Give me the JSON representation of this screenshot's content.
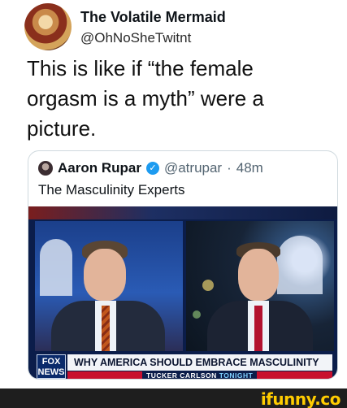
{
  "outer_tweet": {
    "name": "The Volatile Mermaid",
    "handle": "@OhNoSheTwitnt",
    "text": "This is like if “the female orgasm is a myth” were a picture."
  },
  "quoted_tweet": {
    "name": "Aaron Rupar",
    "verified_symbol": "✓",
    "handle": "@atrupar",
    "separator": "·",
    "time": "48m",
    "text": "The Masculinity Experts"
  },
  "broadcast": {
    "network_logo": "FOX NEWS",
    "headline": "WHY AMERICA SHOULD EMBRACE MASCULINITY",
    "show_name": "TUCKER CARLSON",
    "show_tag": "TONIGHT",
    "colors": {
      "headline_bg": "#f2f4f8",
      "accent_red": "#c8102e",
      "fox_blue": "#0a2a6b"
    }
  },
  "watermark": {
    "text": "ifunny.co",
    "color": "#ffcc00"
  }
}
